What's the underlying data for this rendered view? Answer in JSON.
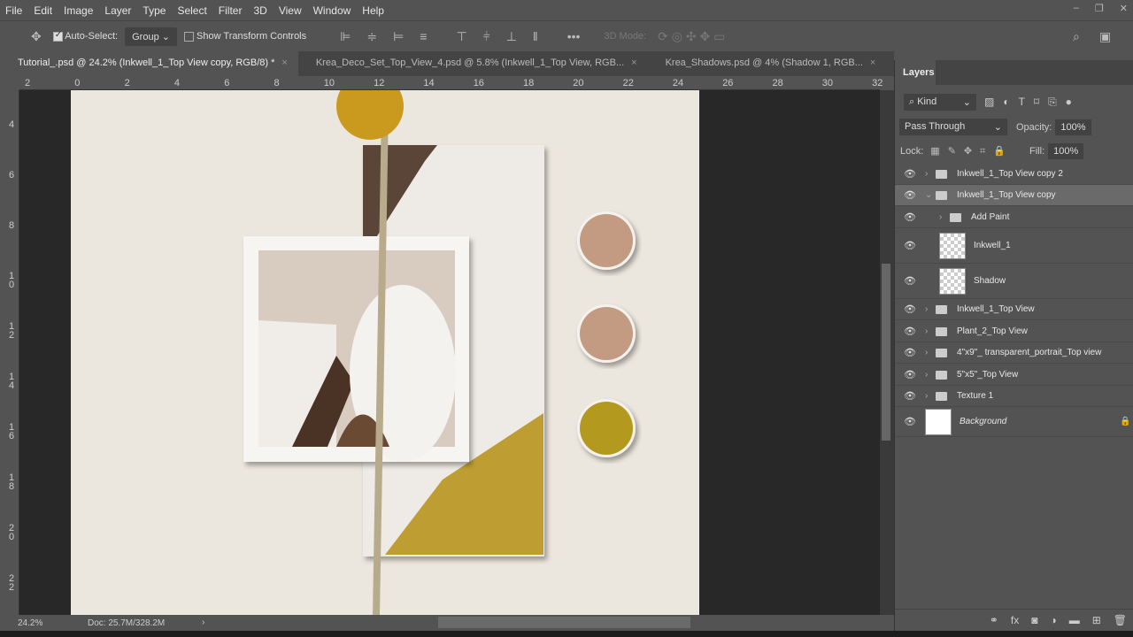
{
  "menu": [
    "File",
    "Edit",
    "Image",
    "Layer",
    "Type",
    "Select",
    "Filter",
    "3D",
    "View",
    "Window",
    "Help"
  ],
  "options": {
    "auto_select": "Auto-Select:",
    "group": "Group",
    "show_transform": "Show Transform Controls",
    "mode_3d": "3D Mode:"
  },
  "tabs": [
    {
      "label": "Tutorial_.psd @ 24.2% (Inkwell_1_Top View copy, RGB/8) *"
    },
    {
      "label": "Krea_Deco_Set_Top_View_4.psd @ 5.8% (Inkwell_1_Top View, RGB..."
    },
    {
      "label": "Krea_Shadows.psd @ 4% (Shadow 1, RGB..."
    }
  ],
  "ruler_top": [
    "2",
    "0",
    "2",
    "4",
    "6",
    "8",
    "10",
    "12",
    "14",
    "16",
    "18",
    "20",
    "22",
    "24",
    "26",
    "28",
    "30",
    "32"
  ],
  "ruler_left": [
    "4",
    "6",
    "8",
    "1 0",
    "1 2",
    "1 4",
    "1 6",
    "1 8",
    "2 0",
    "2 2"
  ],
  "status": {
    "zoom": "24.2%",
    "doc": "Doc: 25.7M/328.2M"
  },
  "layers_panel": {
    "title": "Layers",
    "kind": "Kind",
    "blend": "Pass Through",
    "opacity_label": "Opacity:",
    "opacity": "100%",
    "lock_label": "Lock:",
    "fill_label": "Fill:",
    "fill": "100%",
    "layers": [
      {
        "name": "Inkwell_1_Top View copy 2",
        "type": "group"
      },
      {
        "name": "Inkwell_1_Top View copy",
        "type": "group",
        "selected": true
      },
      {
        "name": "Add Paint",
        "type": "group"
      },
      {
        "name": "Inkwell_1",
        "type": "layer"
      },
      {
        "name": "Shadow",
        "type": "layer"
      },
      {
        "name": "Inkwell_1_Top View",
        "type": "group"
      },
      {
        "name": "Plant_2_Top View",
        "type": "group"
      },
      {
        "name": "4\"x9\"_ transparent_portrait_Top view",
        "type": "group"
      },
      {
        "name": "5\"x5\"_Top View",
        "type": "group"
      },
      {
        "name": "Texture 1",
        "type": "group"
      },
      {
        "name": "Background",
        "type": "background"
      }
    ]
  },
  "colors": {
    "swatch1": "#c39a82",
    "swatch2": "#c39a82",
    "swatch3": "#b39a1f"
  }
}
